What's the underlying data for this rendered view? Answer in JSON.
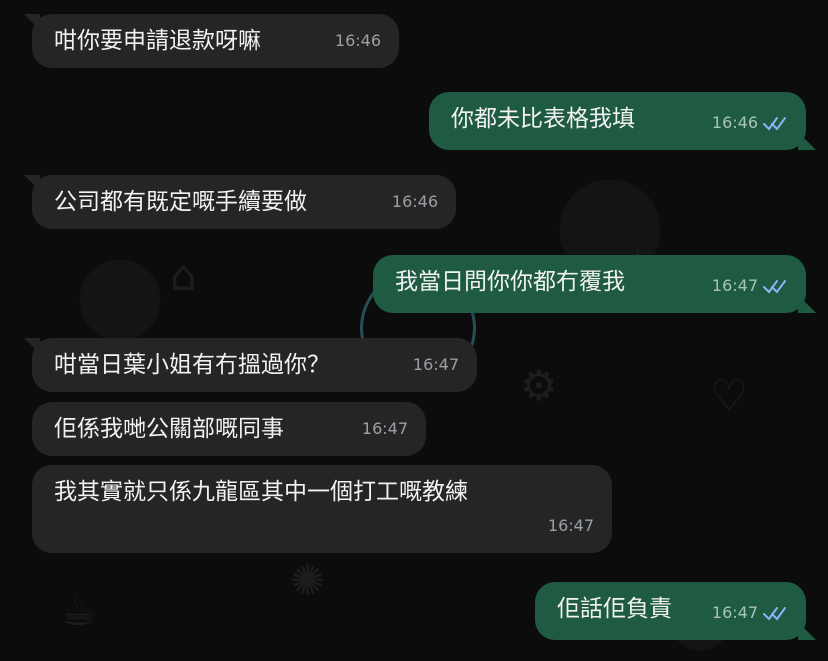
{
  "messages": [
    {
      "id": 1,
      "sender": "them",
      "text": "咁你要申請退款呀嘛",
      "time": "16:46",
      "read": false
    },
    {
      "id": 2,
      "sender": "me",
      "text": "你都未比表格我填",
      "time": "16:46",
      "read": true
    },
    {
      "id": 3,
      "sender": "them",
      "text": "公司都有既定嘅手續要做",
      "time": "16:46",
      "read": false
    },
    {
      "id": 4,
      "sender": "me",
      "text": "我當日問你你都冇覆我",
      "time": "16:47",
      "read": true
    },
    {
      "id": 5,
      "sender": "them",
      "text": "咁當日葉小姐有冇搵過你？",
      "time": "16:47",
      "read": false
    },
    {
      "id": 6,
      "sender": "them",
      "text": "佢係我哋公關部嘅同事",
      "time": "16:47",
      "read": false
    },
    {
      "id": 7,
      "sender": "them",
      "text": "我其實就只係九龍區其中一個打工嘅教練",
      "time": "16:47",
      "read": false
    },
    {
      "id": 8,
      "sender": "me",
      "text": "佢話佢負責",
      "time": "16:47",
      "read": true
    }
  ],
  "colors": {
    "incoming": "#252525",
    "outgoing": "#1f5b43",
    "read_tick": "#8ab4f8"
  },
  "icons": {
    "read_receipt": "double-check-icon"
  }
}
